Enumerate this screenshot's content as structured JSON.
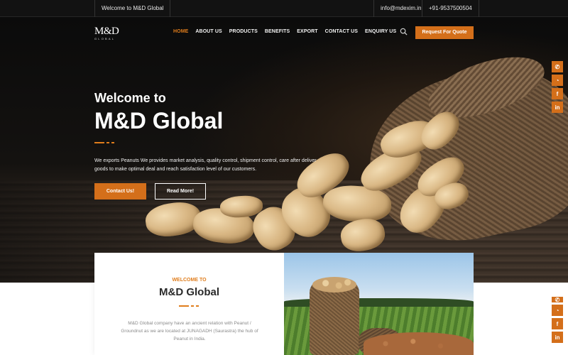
{
  "topbar": {
    "welcome": "Welcome to M&D Global",
    "email": "info@mdexim.in",
    "phone": "+91-9537500504"
  },
  "nav": {
    "logo": "M&D",
    "logo_sub": "GLOBAL",
    "items": [
      {
        "label": "HOME",
        "active": true
      },
      {
        "label": "ABOUT US",
        "active": false
      },
      {
        "label": "PRODUCTS",
        "active": false
      },
      {
        "label": "BENEFITS",
        "active": false
      },
      {
        "label": "EXPORT",
        "active": false
      },
      {
        "label": "CONTACT US",
        "active": false
      },
      {
        "label": "ENQUIRY US",
        "active": false
      }
    ],
    "search_icon": "search-icon",
    "quote_button": "Request For Quote"
  },
  "hero": {
    "subtitle": "Welcome to",
    "title": "M&D Global",
    "description": "We exports Peanuts We provides market analysis, quality control, shipment control, care after deliver goods to make optimal deal and reach satisfaction level of our customers.",
    "contact_button": "Contact Us!",
    "read_button": "Read More!"
  },
  "social": {
    "icons": [
      "phone-icon",
      "whatsapp-icon",
      "facebook-icon",
      "linkedin-icon"
    ],
    "glyphs": [
      "✆",
      "◔",
      "f",
      "in"
    ]
  },
  "about": {
    "kicker": "WELCOME TO",
    "title": "M&D Global",
    "text": "M&D Global company have an ancient relation with Peanut / Groundnut as we are located at JUNAGADH (Saurastra) the hub of Peanut in India."
  },
  "colors": {
    "accent": "#d46f1a",
    "active_nav": "#e07d1c",
    "dark": "#121212"
  }
}
